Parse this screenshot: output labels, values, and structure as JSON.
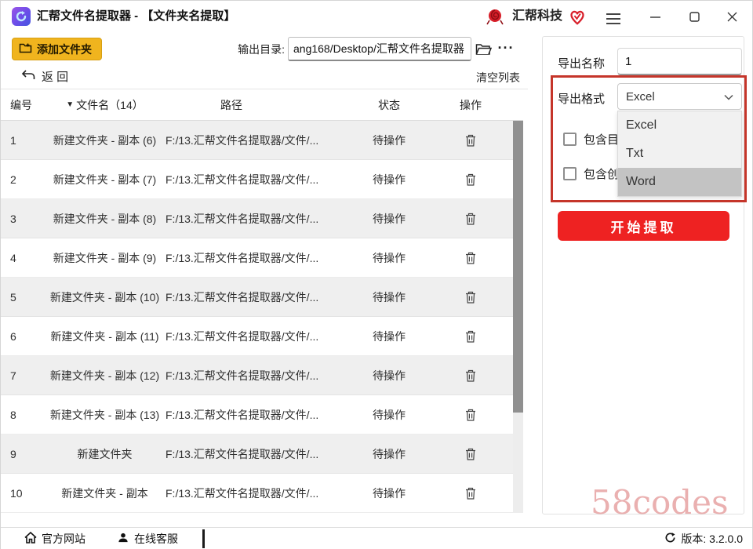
{
  "titlebar": {
    "title": "汇帮文件名提取器 - 【文件夹名提取】",
    "brand": "汇帮科技"
  },
  "toolbar": {
    "add_folder": "添加文件夹",
    "output_label": "输出目录:",
    "output_value": "ang168/Desktop/汇帮文件名提取器",
    "more": "···"
  },
  "listbar": {
    "back": "返 回",
    "clear": "清空列表"
  },
  "table": {
    "headers": {
      "index": "编号",
      "name": "文件名（14）",
      "path": "路径",
      "status": "状态",
      "action": "操作"
    },
    "rows": [
      {
        "index": "1",
        "name": "新建文件夹 - 副本 (6)",
        "path": "F:/13.汇帮文件名提取器/文件/...",
        "status": "待操作"
      },
      {
        "index": "2",
        "name": "新建文件夹 - 副本 (7)",
        "path": "F:/13.汇帮文件名提取器/文件/...",
        "status": "待操作"
      },
      {
        "index": "3",
        "name": "新建文件夹 - 副本 (8)",
        "path": "F:/13.汇帮文件名提取器/文件/...",
        "status": "待操作"
      },
      {
        "index": "4",
        "name": "新建文件夹 - 副本 (9)",
        "path": "F:/13.汇帮文件名提取器/文件/...",
        "status": "待操作"
      },
      {
        "index": "5",
        "name": "新建文件夹 - 副本 (10)",
        "path": "F:/13.汇帮文件名提取器/文件/...",
        "status": "待操作"
      },
      {
        "index": "6",
        "name": "新建文件夹 - 副本 (11)",
        "path": "F:/13.汇帮文件名提取器/文件/...",
        "status": "待操作"
      },
      {
        "index": "7",
        "name": "新建文件夹 - 副本 (12)",
        "path": "F:/13.汇帮文件名提取器/文件/...",
        "status": "待操作"
      },
      {
        "index": "8",
        "name": "新建文件夹 - 副本 (13)",
        "path": "F:/13.汇帮文件名提取器/文件/...",
        "status": "待操作"
      },
      {
        "index": "9",
        "name": "新建文件夹",
        "path": "F:/13.汇帮文件名提取器/文件/...",
        "status": "待操作"
      },
      {
        "index": "10",
        "name": "新建文件夹 - 副本",
        "path": "F:/13.汇帮文件名提取器/文件/...",
        "status": "待操作"
      }
    ]
  },
  "panel": {
    "export_name_label": "导出名称",
    "export_name_value": "1",
    "export_format_label": "导出格式",
    "export_format_value": "Excel",
    "options": [
      "Excel",
      "Txt",
      "Word"
    ],
    "highlighted_option": "Word",
    "checkbox1_label": "包含目",
    "checkbox2_label": "包含创",
    "start_button": "开始提取"
  },
  "footer": {
    "site": "官方网站",
    "support": "在线客服",
    "version": "版本: 3.2.0.0"
  },
  "watermark": "58codes",
  "colors": {
    "accent_yellow": "#f0b41e",
    "accent_red": "#ee2222",
    "annotation_red": "#c5352a",
    "row_alt_gray": "#efefef"
  }
}
